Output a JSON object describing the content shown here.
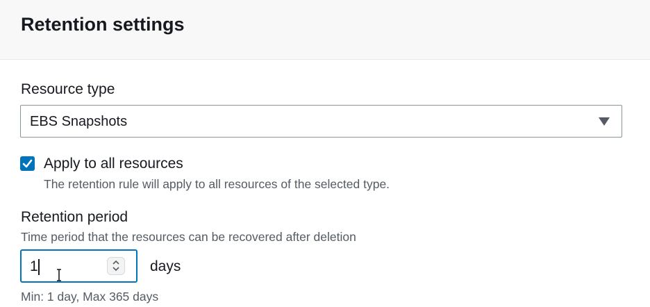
{
  "section": {
    "title": "Retention settings"
  },
  "resource_type": {
    "label": "Resource type",
    "selected": "EBS Snapshots"
  },
  "apply_all": {
    "checked": true,
    "label": "Apply to all resources",
    "description": "The retention rule will apply to all resources of the selected type."
  },
  "retention_period": {
    "label": "Retention period",
    "description": "Time period that the resources can be recovered after deletion",
    "value": "1",
    "unit": "days",
    "constraint": "Min: 1 day, Max 365 days"
  },
  "colors": {
    "accent": "#0073bb",
    "header_bg": "#f8f8f8",
    "text": "#16191f",
    "secondary_text": "#545b64"
  },
  "icons": {
    "select_caret": "caret-down-icon",
    "checkbox": "checkmark-icon",
    "spinner": "chevron-up-down-icon",
    "cursor": "text-cursor-icon"
  }
}
